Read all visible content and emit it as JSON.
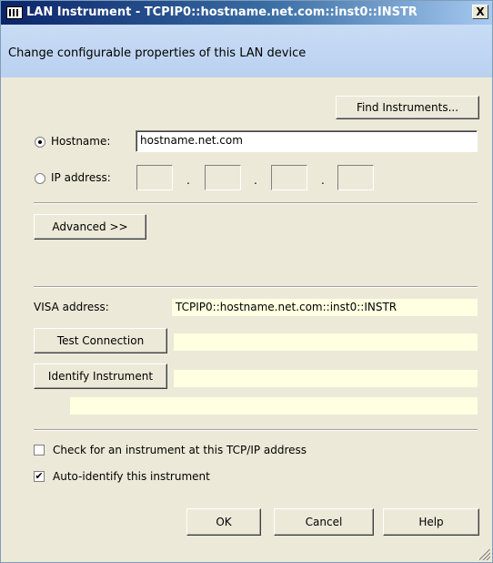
{
  "window": {
    "title": "LAN Instrument - TCPIP0::hostname.net.com::inst0::INSTR",
    "close_glyph": "X",
    "header_text": "Change configurable properties of this LAN device"
  },
  "buttons": {
    "find_instruments": "Find Instruments...",
    "advanced": "Advanced >>",
    "test_connection": "Test Connection",
    "identify_instrument": "Identify Instrument",
    "ok": "OK",
    "cancel": "Cancel",
    "help": "Help"
  },
  "hostname": {
    "label": "Hostname:",
    "value": "hostname.net.com",
    "selected": true
  },
  "ip_address": {
    "label": "IP address:",
    "octets": [
      "",
      "",
      "",
      ""
    ],
    "separator": "."
  },
  "visa": {
    "label": "VISA address:",
    "value": "TCPIP0::hostname.net.com::inst0::INSTR"
  },
  "checks": {
    "check_tcpip_label": "Check for an instrument at this TCP/IP address",
    "check_tcpip_checked": false,
    "auto_identify_label": "Auto-identify this instrument",
    "auto_identify_checked": true,
    "check_glyph": "✔"
  }
}
